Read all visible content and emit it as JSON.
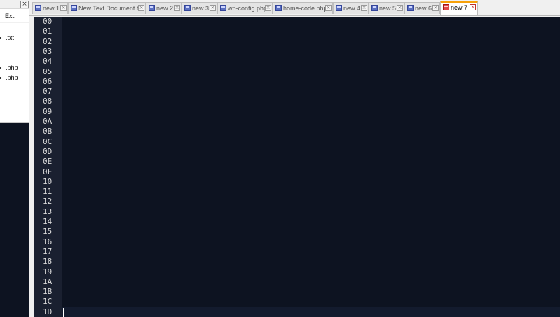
{
  "file_panel": {
    "close_glyph": "×",
    "column_header": "Ext.",
    "extensions": [
      ".txt",
      ".php",
      ".php"
    ]
  },
  "tabs": [
    {
      "label": "new 1",
      "active": false
    },
    {
      "label": "New Text Document.txt",
      "active": false
    },
    {
      "label": "new 2",
      "active": false
    },
    {
      "label": "new 3",
      "active": false
    },
    {
      "label": "wp-config.php",
      "active": false
    },
    {
      "label": "home-code.php",
      "active": false
    },
    {
      "label": "new 4",
      "active": false
    },
    {
      "label": "new 5",
      "active": false
    },
    {
      "label": "new 6",
      "active": false
    },
    {
      "label": "new 7",
      "active": true
    }
  ],
  "tab_close_glyph": "×",
  "editor": {
    "line_numbers": [
      "00",
      "01",
      "02",
      "03",
      "04",
      "05",
      "06",
      "07",
      "08",
      "09",
      "0A",
      "0B",
      "0C",
      "0D",
      "0E",
      "0F",
      "10",
      "11",
      "12",
      "13",
      "14",
      "15",
      "16",
      "17",
      "18",
      "19",
      "1A",
      "1B",
      "1C",
      "1D"
    ]
  },
  "colors": {
    "editor_background": "#0d1321",
    "gutter_background": "#1a2030",
    "active_tab_accent": "#f7a10a",
    "line_number_text": "#dcdcdc"
  }
}
